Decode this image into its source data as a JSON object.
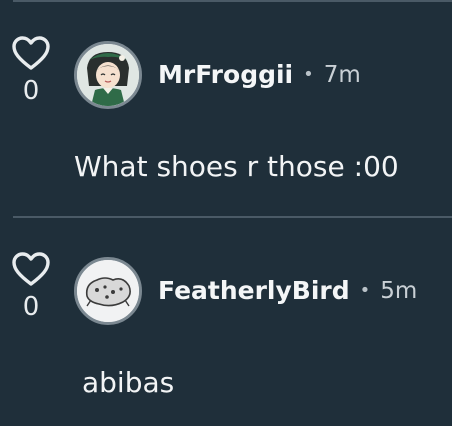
{
  "comments": [
    {
      "username": "MrFroggii",
      "separator": "•",
      "time": "7m",
      "like_count": "0",
      "text": "What shoes r those :00",
      "avatar_icon": "anime-character-avatar"
    },
    {
      "username": "FeatherlyBird",
      "separator": "•",
      "time": "5m",
      "like_count": "0",
      "text": "abibas",
      "avatar_icon": "cookie-sketch-avatar"
    }
  ],
  "colors": {
    "background": "#1f2f3a",
    "divider": "#4a5a66",
    "text": "#f2f4f5",
    "muted": "#c9d0d5"
  }
}
